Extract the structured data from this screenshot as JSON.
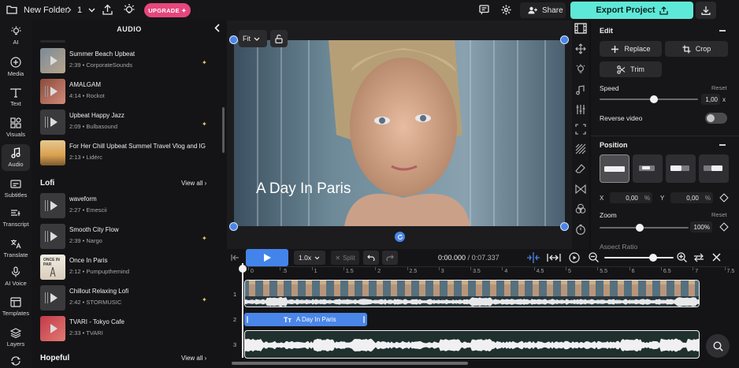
{
  "topbar": {
    "folder": "New Folder",
    "page_num": "1",
    "upgrade": "UPGRADE",
    "share": "Share",
    "export": "Export Project"
  },
  "nav": [
    {
      "label": "AI",
      "icon": "bulb-icon"
    },
    {
      "label": "Media",
      "icon": "plus-icon"
    },
    {
      "label": "Text",
      "icon": "text-icon"
    },
    {
      "label": "Visuals",
      "icon": "shapes-icon"
    },
    {
      "label": "Audio",
      "icon": "music-note-icon"
    },
    {
      "label": "Subtitles",
      "icon": "subtitles-icon"
    },
    {
      "label": "Transcript",
      "icon": "transcript-icon"
    },
    {
      "label": "Translate",
      "icon": "translate-icon"
    },
    {
      "label": "AI Voice",
      "icon": "voice-icon"
    },
    {
      "label": "Templates",
      "icon": "templates-icon"
    },
    {
      "label": "Layers",
      "icon": "layers-icon"
    }
  ],
  "audio_panel": {
    "title": "AUDIO",
    "tracks_top": [
      {
        "title": "Summer Beach Upbeat",
        "meta": "2:39 • CorporateSounds",
        "sparkle": true
      },
      {
        "title": "AMALGAM",
        "meta": "4:14 • Rockot",
        "sparkle": false
      },
      {
        "title": "Upbeat Happy Jazz",
        "meta": "2:09 • Bulbasound",
        "sparkle": true
      },
      {
        "title": "For Her Chill Upbeat Summel Travel Vlog and IG",
        "meta": "2:13 • Lidérc",
        "sparkle": false
      }
    ],
    "lofi_title": "Lofi",
    "view_all": "View all",
    "tracks_lofi": [
      {
        "title": "waveform",
        "meta": "2:27 • Emescii",
        "sparkle": false
      },
      {
        "title": "Smooth City Flow",
        "meta": "2:39 • Nargo",
        "sparkle": true
      },
      {
        "title": "Once In Paris",
        "meta": "2:12 • Pumpupthemind",
        "sparkle": false
      },
      {
        "title": "Chillout Relaxing Lofi",
        "meta": "2:42 • STORMUSIC",
        "sparkle": true
      },
      {
        "title": "TVARI - Tokyo Cafe",
        "meta": "2:33 • TVARI",
        "sparkle": false
      }
    ],
    "hopeful_title": "Hopeful",
    "once_paris_thumb": "ONCE IN PAR"
  },
  "canvas": {
    "fit": "Fit",
    "overlay_text": "A Day In Paris"
  },
  "props": {
    "edit_title": "Edit",
    "replace": "Replace",
    "crop": "Crop",
    "trim": "Trim",
    "speed_label": "Speed",
    "reset": "Reset",
    "speed_value": "1,00",
    "speed_unit": "x",
    "speed_level": 0.55,
    "reverse_label": "Reverse video",
    "position_title": "Position",
    "x_label": "X",
    "x_value": "0,00",
    "y_label": "Y",
    "y_value": "0,00",
    "pct": "%",
    "zoom_label": "Zoom",
    "zoom_value": "100%",
    "zoom_level": 0.45,
    "aspect_label": "Aspect Ratio"
  },
  "timeline": {
    "speed": "1.0x",
    "split": "Split",
    "time_current": "0:00.000",
    "time_total": "/ 0:07.337",
    "ticks": [
      "0",
      ".5",
      "1",
      "1.5",
      "2",
      "2.5",
      "3",
      "3.5",
      "4",
      "4.5",
      "5",
      "5.5",
      "6",
      "6.5",
      "7",
      "7.5"
    ],
    "rows": [
      "1",
      "2",
      "3"
    ],
    "text_clip": "A Day In Paris",
    "zoom_level": 0.7
  }
}
